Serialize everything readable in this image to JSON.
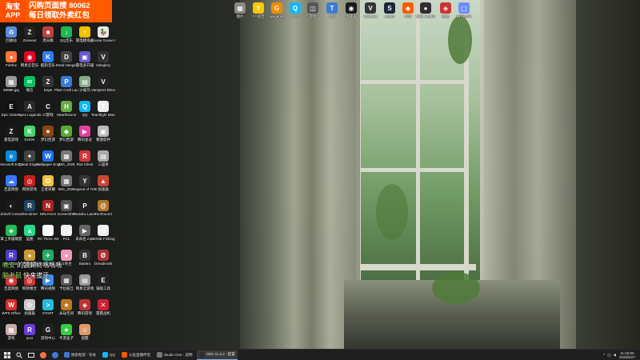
{
  "promo": {
    "app_line1": "淘宝",
    "app_line2": "APP",
    "text_line1": "闪购页面搜 80062",
    "text_line2": "每日领取外卖红包"
  },
  "overlays": {
    "line1_name": "晚安",
    "line1_text": "的讀歸終嗎嗎嗎",
    "line2_name": "脑老鼠",
    "line2_text": "快来拔牙"
  },
  "icons": [
    {
      "label": "回收站",
      "color": "#5b8bd8",
      "glyph": "♻"
    },
    {
      "label": "Zoneout",
      "color": "#222",
      "glyph": "Z"
    },
    {
      "label": "黑白棋",
      "color": "#c04040",
      "glyph": "■"
    },
    {
      "label": "QQ音乐",
      "color": "#1db954",
      "glyph": "♪"
    },
    {
      "label": "雷电模拟器",
      "color": "#f2c200",
      "glyph": "⚡"
    },
    {
      "label": "Goose Goose Duck",
      "color": "#e8e8e8",
      "glyph": "🦆"
    },
    {
      "label": "Firefox",
      "color": "#ff7139",
      "glyph": "●"
    },
    {
      "label": "网易云音乐",
      "color": "#e60026",
      "glyph": "◉"
    },
    {
      "label": "酷狗音乐",
      "color": "#2f7cf6",
      "glyph": "K"
    },
    {
      "label": "Dead Hanger",
      "color": "#444",
      "glyph": "D"
    },
    {
      "label": "雷电多开器",
      "color": "#6a5acd",
      "glyph": "▣"
    },
    {
      "label": "Vainglory",
      "color": "#333",
      "glyph": "V"
    },
    {
      "label": "99998.jpg",
      "color": "#999",
      "glyph": "▦"
    },
    {
      "label": "微信",
      "color": "#07c160",
      "glyph": "✉"
    },
    {
      "label": "Dope",
      "color": "#333",
      "glyph": "Z"
    },
    {
      "label": "Plain Craft Launcher",
      "color": "#3a7bd5",
      "glyph": "P"
    },
    {
      "label": "沙威玛",
      "color": "#8a8",
      "glyph": "▤"
    },
    {
      "label": "Vampires Bloodlines",
      "color": "#222",
      "glyph": "V"
    },
    {
      "label": "Epic Games",
      "color": "#111",
      "glyph": "E"
    },
    {
      "label": "Apex Legends",
      "color": "#2a2a2a",
      "glyph": "A"
    },
    {
      "label": "Cf游戏",
      "color": "#1a1a1a",
      "glyph": "C"
    },
    {
      "label": "Hearthstone",
      "color": "#6a4",
      "glyph": "H"
    },
    {
      "label": "QQ",
      "color": "#12b7f5",
      "glyph": "Q"
    },
    {
      "label": "Teamfight Manager",
      "color": "#eee",
      "glyph": "T"
    },
    {
      "label": "雷电游戏",
      "color": "#1a1a1a",
      "glyph": "Z"
    },
    {
      "label": "KOOK",
      "color": "#45d46c",
      "glyph": "K"
    },
    {
      "label": "梦幻西游",
      "color": "#8b4513",
      "glyph": "★"
    },
    {
      "label": "梦幻西游",
      "color": "#5a3",
      "glyph": "◆"
    },
    {
      "label": "腾讯会议",
      "color": "#e040a0",
      "glyph": "▶"
    },
    {
      "label": "看图软件",
      "color": "#bbb",
      "glyph": "▣"
    },
    {
      "label": "Microsoft Edge",
      "color": "#0c88d6",
      "glyph": "e"
    },
    {
      "label": "Cheat Engine",
      "color": "#444",
      "glyph": "✦"
    },
    {
      "label": "Wallpaper Engine",
      "color": "#1f6feb",
      "glyph": "W"
    },
    {
      "label": "IMG_2025",
      "color": "#777",
      "glyph": "▦"
    },
    {
      "label": "Riot Client",
      "color": "#d13639",
      "glyph": "R"
    },
    {
      "label": "三国杀",
      "color": "#aaa",
      "glyph": "▤"
    },
    {
      "label": "百度网盘",
      "color": "#3879fb",
      "glyph": "☁"
    },
    {
      "label": "网易游戏",
      "color": "#c82020",
      "glyph": "◎"
    },
    {
      "label": "王者荣耀",
      "color": "#f0c040",
      "glyph": "✪"
    },
    {
      "label": "IMG_2025",
      "color": "#777",
      "glyph": "▦"
    },
    {
      "label": "Legend of YMIR",
      "color": "#333",
      "glyph": "Y"
    },
    {
      "label": "加速器",
      "color": "#c43",
      "glyph": "▲"
    },
    {
      "label": "Ubisoft Connect",
      "color": "#1a1a1a",
      "glyph": "◐"
    },
    {
      "label": "Omodmer",
      "color": "#246",
      "glyph": "R"
    },
    {
      "label": "NINJAGAI",
      "color": "#a22",
      "glyph": "N"
    },
    {
      "label": "Screenshot",
      "color": "#555",
      "glyph": "▣"
    },
    {
      "label": "Paradox Launcher",
      "color": "#222",
      "glyph": "P"
    },
    {
      "label": "Turnbound",
      "color": "#b0752a",
      "glyph": "@"
    },
    {
      "label": "掌上英雄联盟",
      "color": "#2b5",
      "glyph": "◈"
    },
    {
      "label": "蓝图",
      "color": "#2d8",
      "glyph": "▲"
    },
    {
      "label": "RV There Yet",
      "color": "#fff",
      "glyph": "R"
    },
    {
      "label": "PCL",
      "color": "#eee",
      "glyph": "▢"
    },
    {
      "label": "未命名.mp4",
      "color": "#666",
      "glyph": "▶"
    },
    {
      "label": "GONE Fishing",
      "color": "#eee",
      "glyph": "G"
    },
    {
      "label": "Rockstar",
      "color": "#4b3dcc",
      "glyph": "R"
    },
    {
      "label": "直播伴侣",
      "color": "#c93",
      "glyph": "●"
    },
    {
      "label": "飞书",
      "color": "#2a6",
      "glyph": "✈"
    },
    {
      "label": "斗地主",
      "color": "#e9b",
      "glyph": "♦"
    },
    {
      "label": "Balatro",
      "color": "#333",
      "glyph": "B"
    },
    {
      "label": "Dreadmoth",
      "color": "#a33",
      "glyph": "Ø"
    },
    {
      "label": "百度网盘",
      "color": "#d33",
      "glyph": "◉"
    },
    {
      "label": "网易精灵",
      "color": "#c33",
      "glyph": "◎"
    },
    {
      "label": "腾讯视频",
      "color": "#3a8ee6",
      "glyph": "▶"
    },
    {
      "label": "卡拉彼丘",
      "color": "#555",
      "glyph": "▦"
    },
    {
      "label": "网易云游戏",
      "color": "#999",
      "glyph": "▤"
    },
    {
      "label": "辅助工具",
      "color": "#222",
      "glyph": "E"
    },
    {
      "label": "WPS Office",
      "color": "#d3302e",
      "glyph": "W"
    },
    {
      "label": "加速器",
      "color": "#ccc",
      "glyph": "⚙"
    },
    {
      "label": "START",
      "color": "#2bd",
      "glyph": ">"
    },
    {
      "label": "永劫无间",
      "color": "#b72",
      "glyph": "★"
    },
    {
      "label": "腾讯游戏",
      "color": "#b33",
      "glyph": "◈"
    },
    {
      "label": "雷霆战机",
      "color": "#c23",
      "glyph": "✕"
    },
    {
      "label": "游戏",
      "color": "#caa",
      "glyph": "▦"
    },
    {
      "label": "rpcs",
      "color": "#6a3bd8",
      "glyph": "R"
    },
    {
      "label": "游戏中心",
      "color": "#222",
      "glyph": "G"
    },
    {
      "label": "手游盒子",
      "color": "#3c4",
      "glyph": "★"
    },
    {
      "label": "提醒",
      "color": "#d96",
      "glyph": "☺"
    }
  ],
  "top_icons": [
    {
      "label": "图片",
      "color": "#888",
      "glyph": "▦"
    },
    {
      "label": "YY语音",
      "color": "#f9c900",
      "glyph": "Y"
    },
    {
      "label": "wegame",
      "color": "#f28c00",
      "glyph": "G"
    },
    {
      "label": "QQ",
      "color": "#12b7f5",
      "glyph": "Q"
    },
    {
      "label": "游戏",
      "color": "#555",
      "glyph": "◫"
    },
    {
      "label": "TIM",
      "color": "#3a7bd5",
      "glyph": "T"
    },
    {
      "label": "加速器",
      "color": "#1a1a1a",
      "glyph": "◉"
    },
    {
      "label": "Valorant",
      "color": "#333",
      "glyph": "V"
    },
    {
      "label": "steam",
      "color": "#1b2838",
      "glyph": "S"
    },
    {
      "label": "斗鱼",
      "color": "#ff5a00",
      "glyph": "◆"
    },
    {
      "label": "OBS Studio",
      "color": "#302e31",
      "glyph": "●"
    },
    {
      "label": "网易",
      "color": "#c33",
      "glyph": "◈"
    },
    {
      "label": "腾讯会议",
      "color": "#6a8cff",
      "glyph": "▢"
    }
  ],
  "taskbar": {
    "search_label": "搜索",
    "apps": [
      {
        "label": "搜索框架 - 有关",
        "color": "#3a7bd5"
      },
      {
        "label": "QQ",
        "color": "#12b7f5"
      },
      {
        "label": "斗鱼直播伴侣",
        "color": "#ff5a00"
      },
      {
        "label": "Studio One - 说明",
        "color": "#777"
      },
      {
        "label": "OBS 31.0.2 - 配置",
        "color": "#302e31"
      }
    ],
    "time": "11:25:00",
    "date": "2025/5/27"
  }
}
